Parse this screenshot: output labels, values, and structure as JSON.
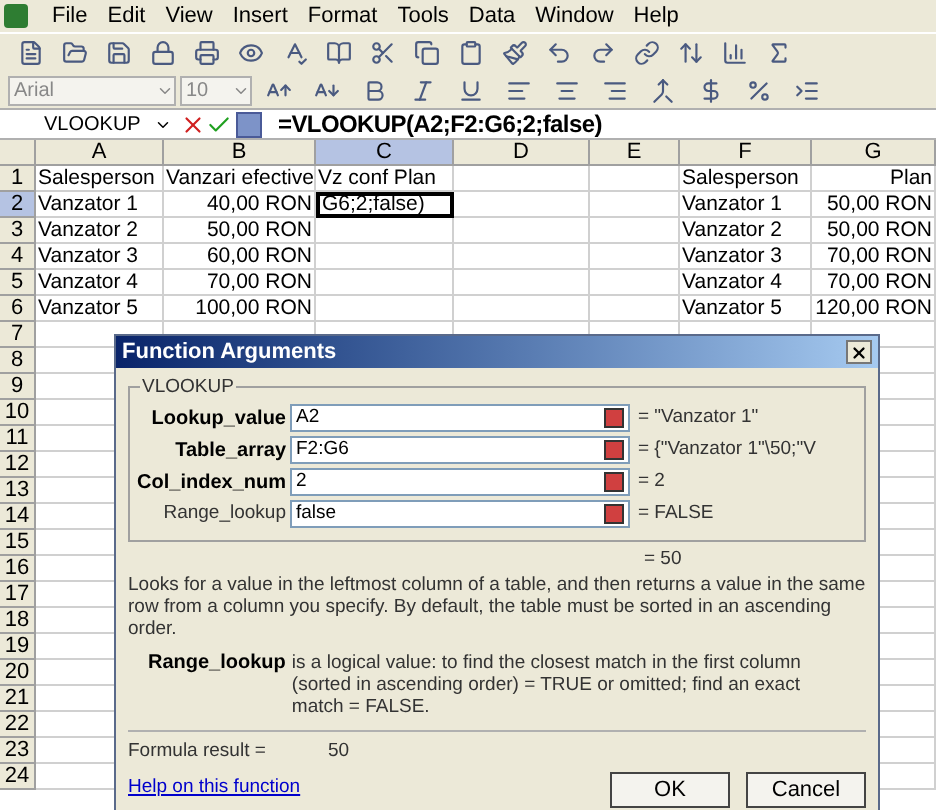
{
  "menu": [
    "File",
    "Edit",
    "View",
    "Insert",
    "Format",
    "Tools",
    "Data",
    "Window",
    "Help"
  ],
  "formatting": {
    "font": "Arial",
    "size": "10"
  },
  "formula_bar": {
    "name_box": "VLOOKUP",
    "formula": "=VLOOKUP(A2;F2:G6;2;false)"
  },
  "columns": [
    {
      "label": "A",
      "selected": false
    },
    {
      "label": "B",
      "selected": false
    },
    {
      "label": "C",
      "selected": true
    },
    {
      "label": "D",
      "selected": false
    },
    {
      "label": "E",
      "selected": false
    },
    {
      "label": "F",
      "selected": false
    },
    {
      "label": "G",
      "selected": false
    }
  ],
  "rows": [
    {
      "number": "1",
      "selected": false,
      "cells": [
        "Salesperson",
        "Vanzari efective",
        "Vz conf Plan",
        null,
        null,
        "Salesperson",
        "Plan"
      ]
    },
    {
      "number": "2",
      "selected": true,
      "cells": [
        "Vanzator 1",
        "40,00 RON",
        "G6;2;false)",
        null,
        null,
        "Vanzator 1",
        "50,00 RON"
      ]
    },
    {
      "number": "3",
      "selected": false,
      "cells": [
        "Vanzator 2",
        "50,00 RON",
        null,
        null,
        null,
        "Vanzator 2",
        "50,00 RON"
      ]
    },
    {
      "number": "4",
      "selected": false,
      "cells": [
        "Vanzator 3",
        "60,00 RON",
        null,
        null,
        null,
        "Vanzator 3",
        "70,00 RON"
      ]
    },
    {
      "number": "5",
      "selected": false,
      "cells": [
        "Vanzator 4",
        "70,00 RON",
        null,
        null,
        null,
        "Vanzator 4",
        "70,00 RON"
      ]
    },
    {
      "number": "6",
      "selected": false,
      "cells": [
        "Vanzator 5",
        "100,00 RON",
        null,
        null,
        null,
        "Vanzator 5",
        "120,00 RON"
      ]
    },
    {
      "number": "7",
      "selected": false
    },
    {
      "number": "8",
      "selected": false
    },
    {
      "number": "9",
      "selected": false
    },
    {
      "number": "10",
      "selected": false
    },
    {
      "number": "11",
      "selected": false
    },
    {
      "number": "12",
      "selected": false
    },
    {
      "number": "13",
      "selected": false
    },
    {
      "number": "14",
      "selected": false
    },
    {
      "number": "15",
      "selected": false
    },
    {
      "number": "16",
      "selected": false
    },
    {
      "number": "17",
      "selected": false
    },
    {
      "number": "18",
      "selected": false
    },
    {
      "number": "19",
      "selected": false
    },
    {
      "number": "20",
      "selected": false
    },
    {
      "number": "21",
      "selected": false
    },
    {
      "number": "22",
      "selected": false
    },
    {
      "number": "23",
      "selected": false
    },
    {
      "number": "24",
      "selected": false
    }
  ],
  "dialog": {
    "title": "Function Arguments",
    "group_label": "VLOOKUP",
    "arguments": [
      {
        "label": "Lookup_value",
        "required": true,
        "value": "A2",
        "result": "= \"Vanzator 1\""
      },
      {
        "label": "Table_array",
        "required": true,
        "value": "F2:G6",
        "result": "= {\"Vanzator 1\"\\50;\"V"
      },
      {
        "label": "Col_index_num",
        "required": true,
        "value": "2",
        "result": "= 2"
      },
      {
        "label": "Range_lookup",
        "required": false,
        "value": "false",
        "result": "= FALSE"
      }
    ],
    "overall_result": "= 50",
    "description": "Looks for a value in the leftmost column of a table, and then returns a value in the same row from a column you specify. By default, the table must be sorted in an ascending order.",
    "argument_help": {
      "label": "Range_lookup",
      "text": "is a logical value: to find the closest match in the first column (sorted in ascending order) = TRUE or omitted; find an exact match = FALSE."
    },
    "formula_result_label": "Formula result =",
    "formula_result": "50",
    "help_link": "Help on this function",
    "buttons": [
      "OK",
      "Cancel"
    ]
  }
}
